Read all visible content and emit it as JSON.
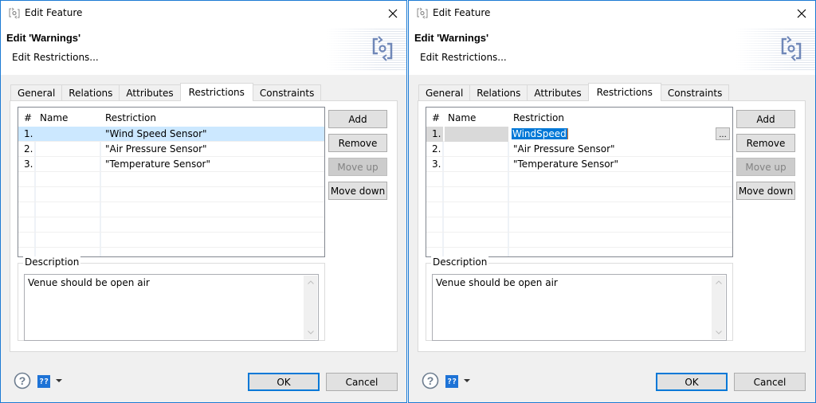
{
  "dialogs": [
    {
      "window_title": "Edit Feature",
      "banner_title": "Edit 'Warnings'",
      "banner_subtitle": "Edit Restrictions...",
      "tabs": [
        {
          "label": "General",
          "active": false
        },
        {
          "label": "Relations",
          "active": false
        },
        {
          "label": "Attributes",
          "active": false
        },
        {
          "label": "Restrictions",
          "active": true
        },
        {
          "label": "Constraints",
          "active": false
        }
      ],
      "table": {
        "columns": [
          "#",
          "Name",
          "Restriction"
        ],
        "rows": [
          {
            "num": "1.",
            "name": "",
            "restriction": "\"Wind Speed Sensor\"",
            "selected": true
          },
          {
            "num": "2.",
            "name": "",
            "restriction": "\"Air Pressure Sensor\"",
            "selected": false
          },
          {
            "num": "3.",
            "name": "",
            "restriction": "\"Temperature Sensor\"",
            "selected": false
          }
        ]
      },
      "buttons": {
        "add": "Add",
        "remove": "Remove",
        "move_up": "Move up",
        "move_down": "Move down"
      },
      "description": {
        "label": "Description",
        "value": "Venue should be open air"
      },
      "footer": {
        "lang_icon": "??",
        "ok": "OK",
        "cancel": "Cancel"
      }
    },
    {
      "window_title": "Edit Feature",
      "banner_title": "Edit 'Warnings'",
      "banner_subtitle": "Edit Restrictions...",
      "tabs": [
        {
          "label": "General",
          "active": false
        },
        {
          "label": "Relations",
          "active": false
        },
        {
          "label": "Attributes",
          "active": false
        },
        {
          "label": "Restrictions",
          "active": true
        },
        {
          "label": "Constraints",
          "active": false
        }
      ],
      "table": {
        "columns": [
          "#",
          "Name",
          "Restriction"
        ],
        "rows": [
          {
            "num": "1.",
            "name": "",
            "restriction": "WindSpeed",
            "editing": true,
            "ellipsis": "..."
          },
          {
            "num": "2.",
            "name": "",
            "restriction": "\"Air Pressure Sensor\"",
            "selected": false
          },
          {
            "num": "3.",
            "name": "",
            "restriction": "\"Temperature Sensor\"",
            "selected": false
          }
        ]
      },
      "buttons": {
        "add": "Add",
        "remove": "Remove",
        "move_up": "Move up",
        "move_down": "Move down"
      },
      "description": {
        "label": "Description",
        "value": "Venue should be open air"
      },
      "footer": {
        "lang_icon": "??",
        "ok": "OK",
        "cancel": "Cancel"
      }
    }
  ],
  "colors": {
    "window_border": "#1c7bd4",
    "selection": "#cce8ff",
    "text_selection": "#0078d7",
    "default_button_border": "#0078d7"
  }
}
